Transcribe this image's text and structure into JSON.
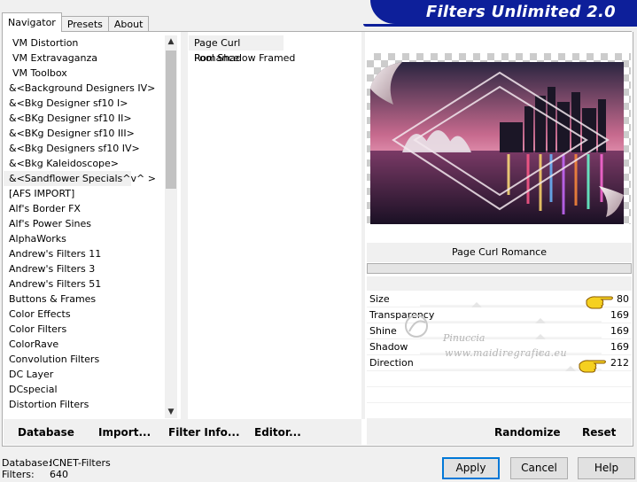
{
  "tabs": [
    {
      "label": "Navigator",
      "active": true
    },
    {
      "label": "Presets",
      "active": false
    },
    {
      "label": "About",
      "active": false
    }
  ],
  "banner": {
    "title": "Filters Unlimited 2.0"
  },
  "categories": [
    "VM Distortion",
    "VM Extravaganza",
    "VM Toolbox",
    "&<Background Designers IV>",
    "&<Bkg Designer sf10 I>",
    "&<BKg Designer sf10 II>",
    "&<BKg Designer sf10 III>",
    "&<Bkg Designers sf10 IV>",
    "&<Bkg Kaleidoscope>",
    "&<Sandflower Specials^v^ >",
    "[AFS IMPORT]",
    "Alf's Border FX",
    "Alf's Power Sines",
    "AlphaWorks",
    "Andrew's Filters 11",
    "Andrew's Filters 3",
    "Andrew's Filters 51",
    "Buttons & Frames",
    "Color Effects",
    "Color Filters",
    "ColorRave",
    "Convolution Filters",
    "DC Layer",
    "DCspecial",
    "Distortion Filters"
  ],
  "selected_category": "&<Sandflower Specials^v^ >",
  "filters": [
    "Page Curl Romance",
    "Pool Shadow Framed"
  ],
  "selected_filter": "Page Curl Romance",
  "filter_title": "Page Curl Romance",
  "params": [
    {
      "label": "Size",
      "value": "80",
      "level": 80
    },
    {
      "label": "Transparency",
      "value": "169",
      "level": 169
    },
    {
      "label": "Shine",
      "value": "169",
      "level": 169
    },
    {
      "label": "Shadow",
      "value": "169",
      "level": 169
    },
    {
      "label": "Direction",
      "value": "212",
      "level": 212
    }
  ],
  "watermark": {
    "line1": "Pinuccia",
    "line2": "www.maidiregrafica.eu"
  },
  "toolbar": {
    "database": "Database",
    "import": "Import...",
    "filter_info": "Filter Info...",
    "editor": "Editor...",
    "randomize": "Randomize",
    "reset": "Reset"
  },
  "status": {
    "database_label": "Database:",
    "database_value": "ICNET-Filters",
    "filters_label": "Filters:",
    "filters_value": "640"
  },
  "buttons": {
    "apply": "Apply",
    "cancel": "Cancel",
    "help": "Help"
  },
  "colors": {
    "banner": "#0d1f9a",
    "accent": "#0078d7"
  },
  "icons": {
    "scroll_up": "chevron-up-icon",
    "scroll_down": "chevron-down-icon",
    "pointer": "pointing-hand-icon"
  }
}
